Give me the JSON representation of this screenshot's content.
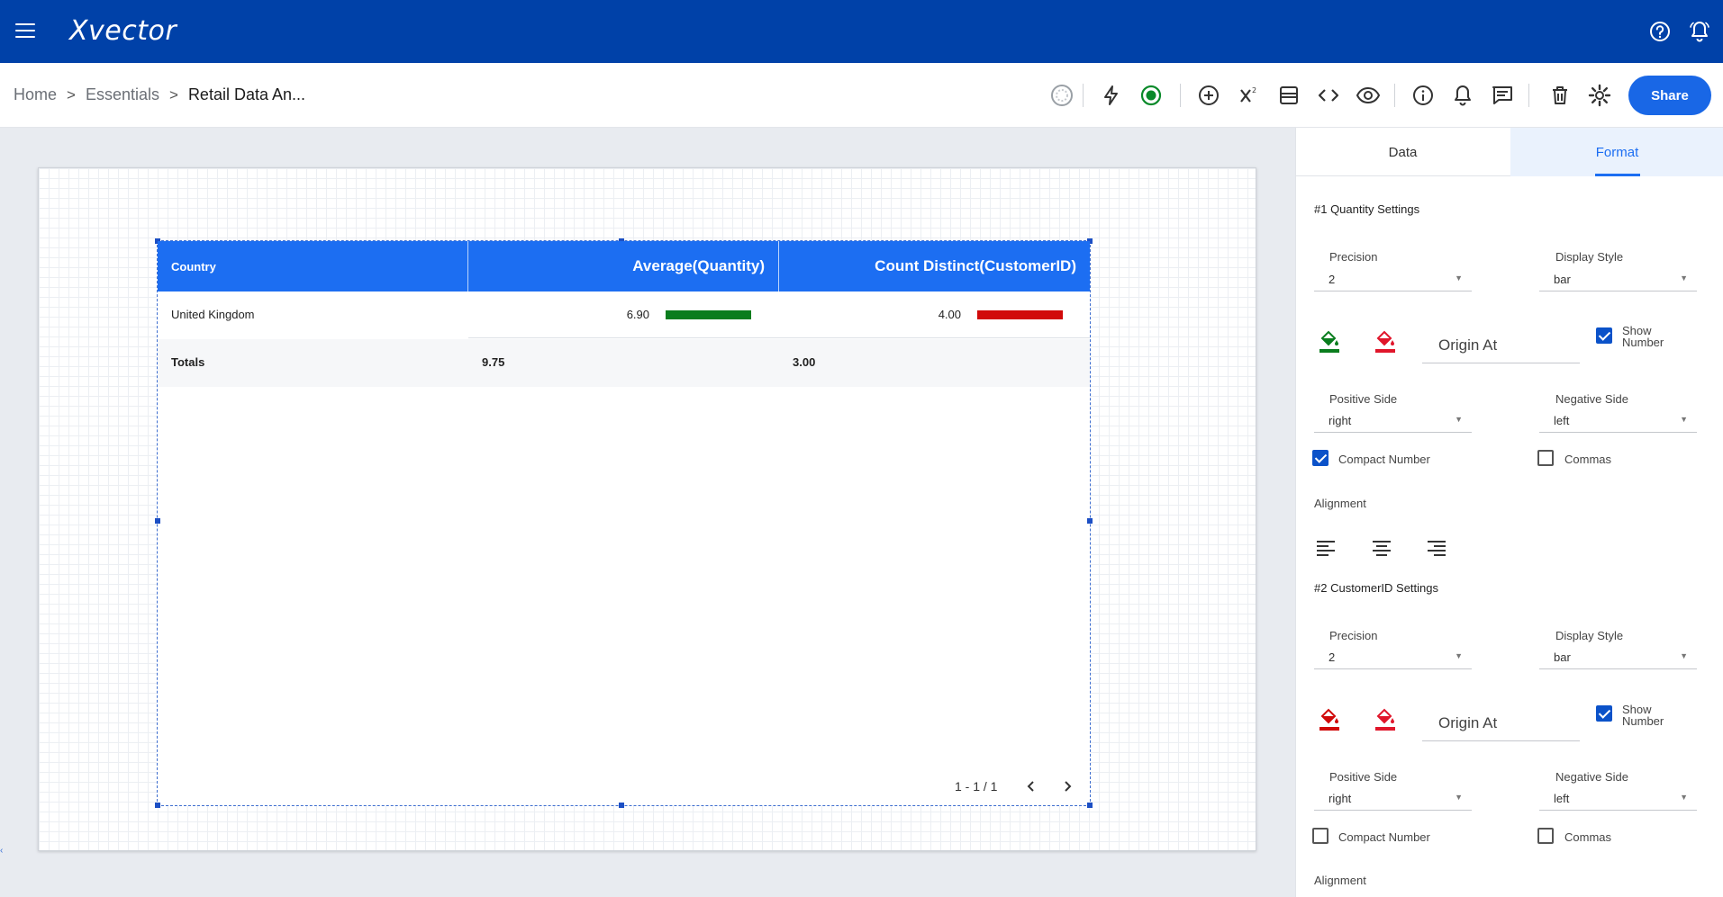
{
  "app": {
    "brand": "Xvector"
  },
  "breadcrumb": {
    "home": "Home",
    "essentials": "Essentials",
    "current": "Retail Data An...",
    "separator": ">"
  },
  "toolbar": {
    "share_label": "Share"
  },
  "table": {
    "columns": [
      "Country",
      "Average(Quantity)",
      "Count Distinct(CustomerID)"
    ],
    "rows": [
      {
        "country": "United Kingdom",
        "avg_quantity": "6.90",
        "count_customer": "4.00"
      }
    ],
    "totals": {
      "label": "Totals",
      "avg_quantity": "9.75",
      "count_customer": "3.00"
    },
    "bar_colors": {
      "quantity": "#0a7d1e",
      "customer": "#d10a0a"
    },
    "pagination": "1 - 1 / 1"
  },
  "panel": {
    "tabs": [
      "Data",
      "Format"
    ],
    "active_tab": "Format",
    "section1": {
      "title": "#1 Quantity Settings",
      "precision_label": "Precision",
      "precision_value": "2",
      "display_style_label": "Display Style",
      "display_style_value": "bar",
      "origin_label": "Origin At",
      "show_number_line1": "Show",
      "show_number_line2": "Number",
      "positive_side_label": "Positive Side",
      "positive_side_value": "right",
      "negative_side_label": "Negative Side",
      "negative_side_value": "left",
      "compact_number_label": "Compact Number",
      "commas_label": "Commas",
      "alignment_label": "Alignment",
      "positive_color": "#0a7d1e",
      "negative_color": "#e0162b"
    },
    "section2": {
      "title": "#2 CustomerID Settings",
      "precision_label": "Precision",
      "precision_value": "2",
      "display_style_label": "Display Style",
      "display_style_value": "bar",
      "origin_label": "Origin At",
      "show_number_line1": "Show",
      "show_number_line2": "Number",
      "positive_side_label": "Positive Side",
      "positive_side_value": "right",
      "negative_side_label": "Negative Side",
      "negative_side_value": "left",
      "compact_number_label": "Compact Number",
      "commas_label": "Commas",
      "alignment_label": "Alignment",
      "positive_color": "#d10a0a",
      "negative_color": "#e0162b"
    }
  }
}
